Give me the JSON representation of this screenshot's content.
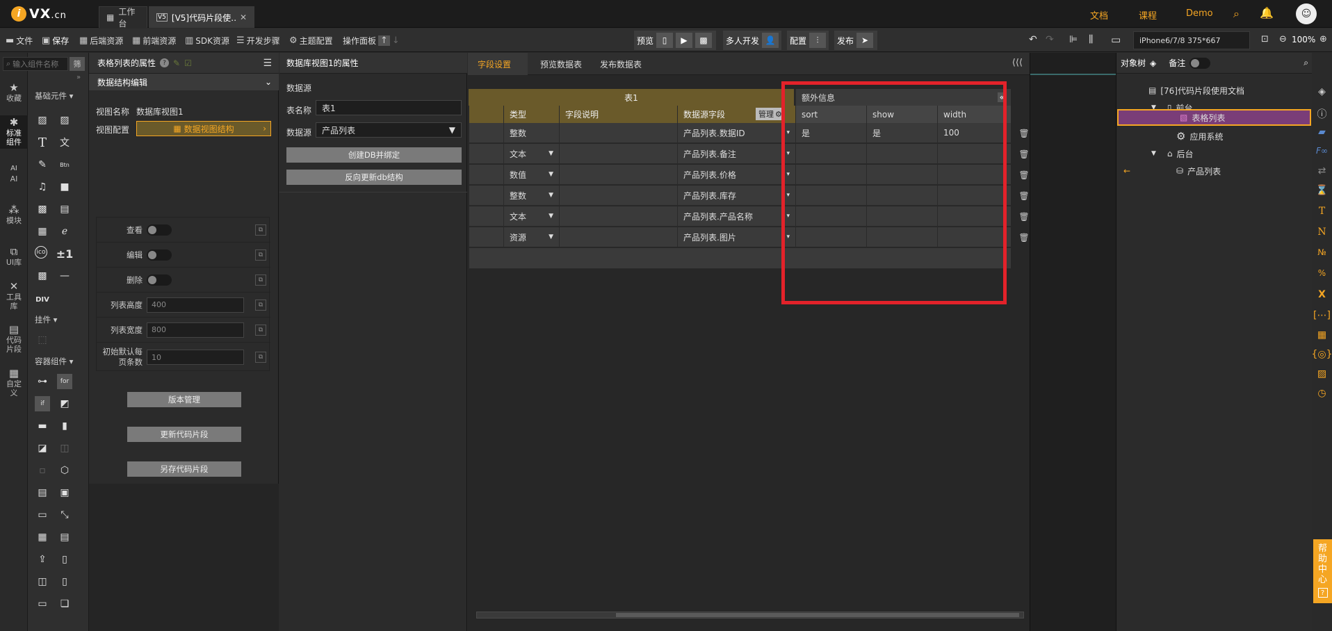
{
  "brand": {
    "logo_letter": "i",
    "logo_text": "VX",
    "logo_suffix": ".cn"
  },
  "tabs": [
    {
      "label": "工作台"
    },
    {
      "label": "[V5]代码片段使…"
    }
  ],
  "top_links": {
    "docs": "文档",
    "course": "课程",
    "demo": "Demo"
  },
  "toolbar": {
    "file": "文件",
    "save": "保存",
    "backend": "后端资源",
    "frontend": "前端资源",
    "sdk": "SDK资源",
    "steps": "开发步骤",
    "theme": "主题配置",
    "panel": "操作面板",
    "preview": "预览",
    "multi_dev": "多人开发",
    "config": "配置",
    "publish": "发布",
    "device": "iPhone6/7/8 375*667",
    "zoom": "100%"
  },
  "rail": [
    {
      "label": "收藏"
    },
    {
      "label": "标准组件"
    },
    {
      "label": "AI"
    },
    {
      "label": "模块"
    },
    {
      "label": "UI库"
    },
    {
      "label": "工具库"
    },
    {
      "label": "代码片段"
    },
    {
      "label": "自定义"
    }
  ],
  "palette": {
    "search_placeholder": "输入组件名称",
    "filter": "筛",
    "basic": "基础元件",
    "plugin": "挂件",
    "container": "容器组件",
    "div": "DIV",
    "pm": "±1",
    "for": "for",
    "if": "if"
  },
  "props": {
    "title": "表格列表的属性",
    "section": "数据结构编辑",
    "view_name_label": "视图名称",
    "view_name": "数据库视图1",
    "view_config_label": "视图配置",
    "view_config_btn": "数据视图结构",
    "rows": [
      {
        "label": "查看"
      },
      {
        "label": "编辑"
      },
      {
        "label": "删除"
      }
    ],
    "list_height_label": "列表高度",
    "list_height": "400",
    "list_width_label": "列表宽度",
    "list_width": "800",
    "page_size_label": "初始默认每页条数",
    "page_size": "10",
    "btn_version": "版本管理",
    "btn_update": "更新代码片段",
    "btn_saveas": "另存代码片段"
  },
  "dview": {
    "title": "数据库视图1的属性",
    "source_header": "数据源",
    "table_label": "表名称",
    "table_value": "表1",
    "source_label": "数据源",
    "source_value": "产品列表",
    "btn_create": "创建DB并绑定",
    "btn_reverse": "反向更新db结构"
  },
  "main": {
    "tabs": [
      {
        "label": "字段设置"
      },
      {
        "label": "预览数据表"
      },
      {
        "label": "发布数据表"
      }
    ],
    "table_title": "表1",
    "extra_title": "额外信息",
    "col_type": "类型",
    "col_desc": "字段说明",
    "col_source": "数据源字段",
    "manage": "管理",
    "extra_cols": [
      "sort",
      "show",
      "width"
    ],
    "rows": [
      {
        "type": "整数",
        "source": "产品列表.数据ID",
        "sort": "是",
        "show": "是",
        "width": "100"
      },
      {
        "type": "文本",
        "source": "产品列表.备注",
        "sort": "",
        "show": "",
        "width": ""
      },
      {
        "type": "数值",
        "source": "产品列表.价格",
        "sort": "",
        "show": "",
        "width": ""
      },
      {
        "type": "整数",
        "source": "产品列表.库存",
        "sort": "",
        "show": "",
        "width": ""
      },
      {
        "type": "文本",
        "source": "产品列表.产品名称",
        "sort": "",
        "show": "",
        "width": ""
      },
      {
        "type": "资源",
        "source": "产品列表.图片",
        "sort": "",
        "show": "",
        "width": ""
      }
    ]
  },
  "tree": {
    "tab_objects": "对象树",
    "tab_notes": "备注",
    "root": "[76]代码片段使用文档",
    "front": "前台",
    "selected": "表格列表",
    "app_system": "应用系统",
    "back": "后台",
    "product_list": "产品列表"
  },
  "help": [
    "帮",
    "助",
    "中",
    "心",
    "?"
  ],
  "colors": {
    "accent": "#f5a623",
    "header_gold": "#6a5a2a",
    "highlight_red": "#e3222a",
    "selected_purple": "#7a3d78"
  }
}
